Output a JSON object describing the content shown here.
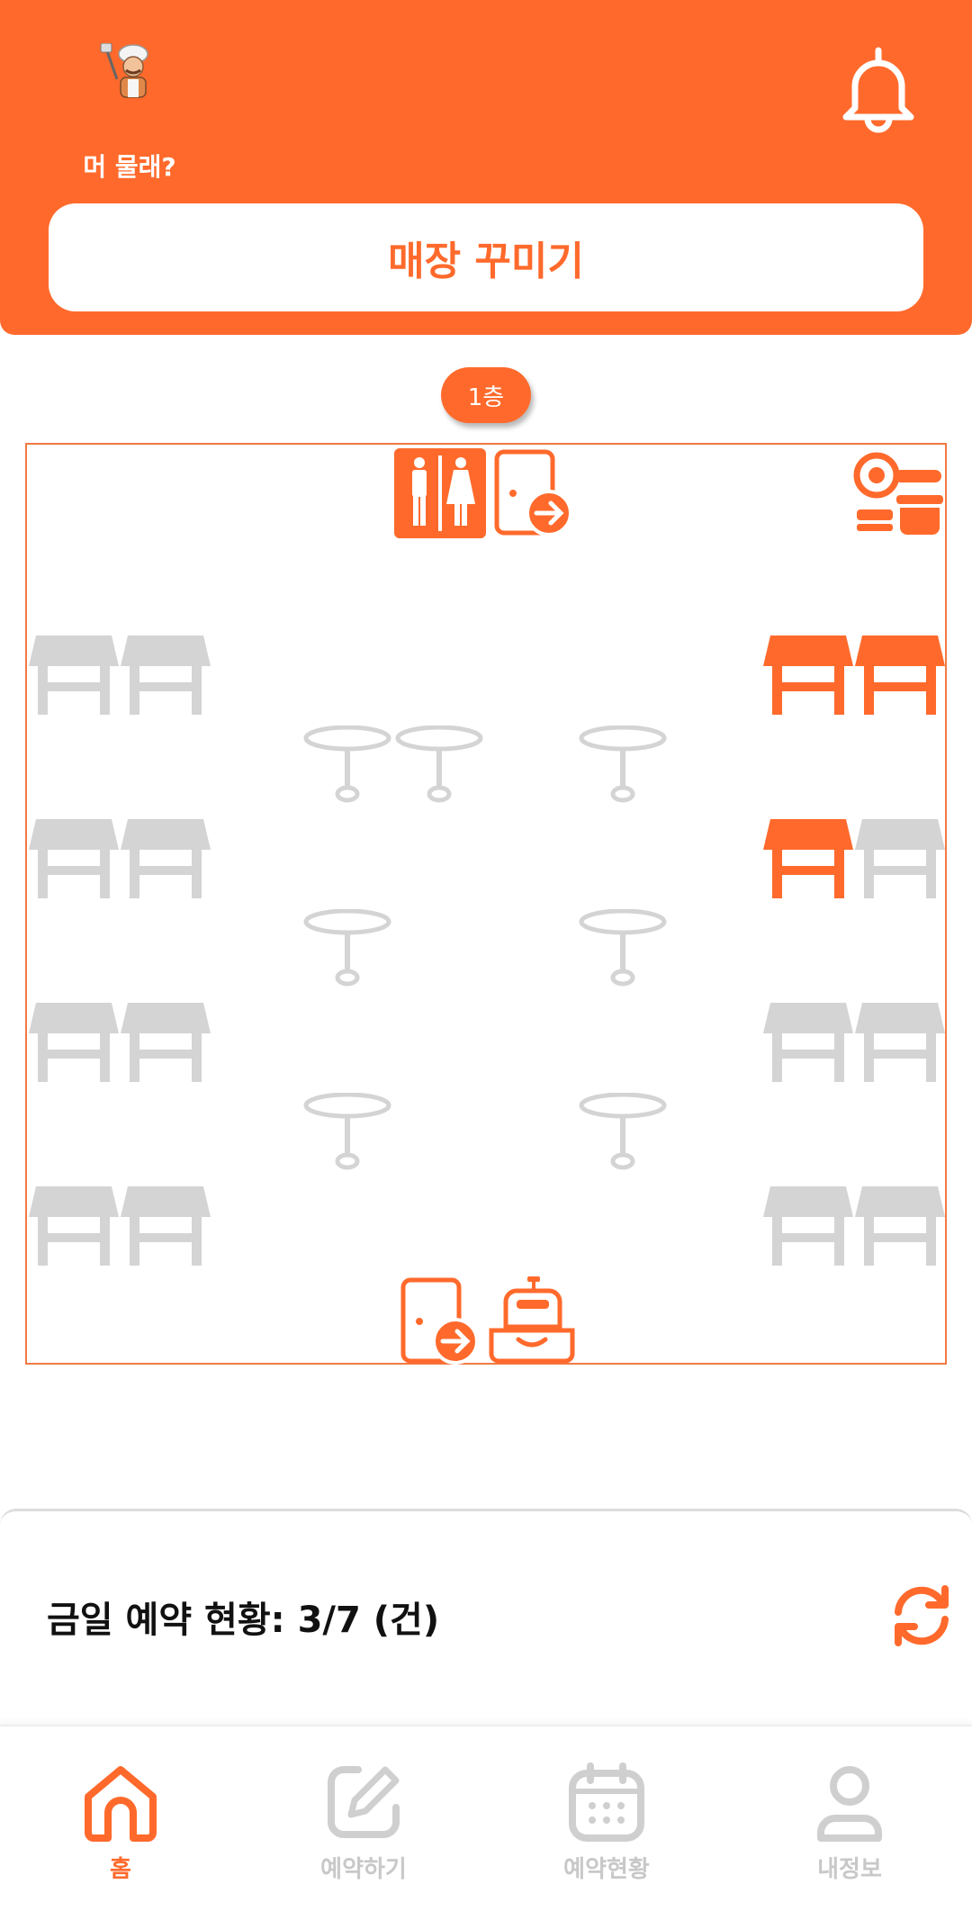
{
  "header": {
    "logo_text": "머 물래?",
    "decorate_button": "매장 꾸미기"
  },
  "floor_selector": {
    "label": "1층"
  },
  "floor_plan": {
    "colors": {
      "reserved": "#FF6A2C",
      "available": "#D4D4D4",
      "fixture": "#FF6A2C",
      "border": "#F07A45"
    },
    "fixtures": [
      "restroom-icon",
      "exit-icon",
      "kitchen-icon",
      "exit-icon",
      "cash-register-icon"
    ],
    "tables": [
      {
        "id": "L1a",
        "kind": "table",
        "reserved": false
      },
      {
        "id": "L1b",
        "kind": "table",
        "reserved": false
      },
      {
        "id": "R1a",
        "kind": "table",
        "reserved": true
      },
      {
        "id": "R1b",
        "kind": "table",
        "reserved": true
      },
      {
        "id": "L2a",
        "kind": "table",
        "reserved": false
      },
      {
        "id": "L2b",
        "kind": "table",
        "reserved": false
      },
      {
        "id": "R2a",
        "kind": "table",
        "reserved": true
      },
      {
        "id": "R2b",
        "kind": "table",
        "reserved": false
      },
      {
        "id": "L3a",
        "kind": "table",
        "reserved": false
      },
      {
        "id": "L3b",
        "kind": "table",
        "reserved": false
      },
      {
        "id": "R3a",
        "kind": "table",
        "reserved": false
      },
      {
        "id": "R3b",
        "kind": "table",
        "reserved": false
      },
      {
        "id": "L4a",
        "kind": "table",
        "reserved": false
      },
      {
        "id": "L4b",
        "kind": "table",
        "reserved": false
      },
      {
        "id": "R4a",
        "kind": "table",
        "reserved": false
      },
      {
        "id": "R4b",
        "kind": "table",
        "reserved": false
      },
      {
        "id": "C1a",
        "kind": "round-table",
        "reserved": false
      },
      {
        "id": "C1b",
        "kind": "round-table",
        "reserved": false
      },
      {
        "id": "C1c",
        "kind": "round-table",
        "reserved": false
      },
      {
        "id": "C2a",
        "kind": "round-table",
        "reserved": false
      },
      {
        "id": "C2b",
        "kind": "round-table",
        "reserved": false
      },
      {
        "id": "C3a",
        "kind": "round-table",
        "reserved": false
      },
      {
        "id": "C3b",
        "kind": "round-table",
        "reserved": false
      }
    ]
  },
  "summary": {
    "text": "금일 예약 현황: 3/7 (건)"
  },
  "bottom_nav": {
    "items": [
      {
        "label": "홈",
        "icon": "home-icon",
        "active": true
      },
      {
        "label": "예약하기",
        "icon": "edit-icon",
        "active": false
      },
      {
        "label": "예약현황",
        "icon": "calendar-icon",
        "active": false
      },
      {
        "label": "내정보",
        "icon": "user-icon",
        "active": false
      }
    ]
  }
}
